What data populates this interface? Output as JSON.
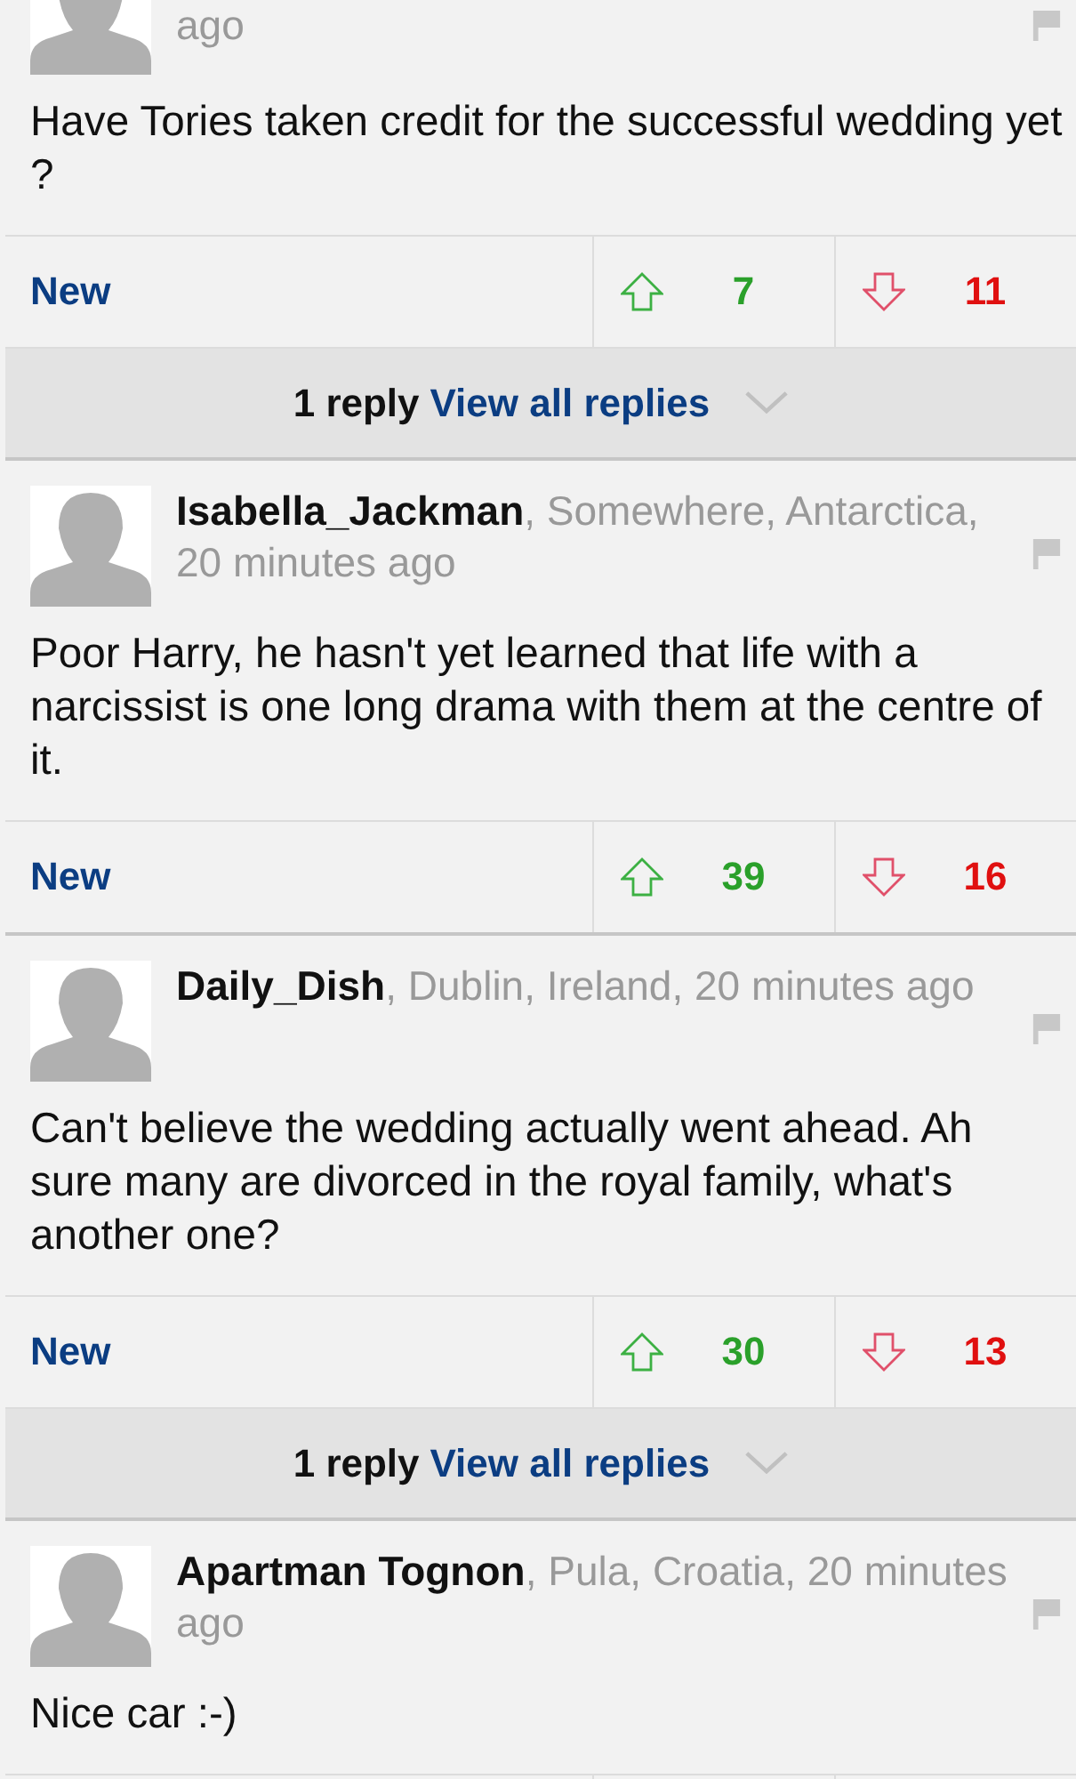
{
  "comments": [
    {
      "meta": "ago",
      "text": "Have Tories taken credit for the successful wedding yet ?",
      "actions": {
        "new_label": "New",
        "up": "7",
        "down": "11"
      },
      "replies": {
        "count": "1 reply",
        "link": "View all replies"
      }
    },
    {
      "name": "Isabella_Jackman",
      "meta": ", Somewhere, Antarctica, 20 minutes ago",
      "text": "Poor Harry, he hasn't yet learned that life with a narcissist is one long drama with them at the centre of it.",
      "actions": {
        "new_label": "New",
        "up": "39",
        "down": "16"
      }
    },
    {
      "name": "Daily_Dish",
      "meta": ", Dublin, Ireland, 20 minutes ago",
      "text": "Can't believe the wedding actually went ahead. Ah sure many are divorced in the royal family, what's another one?",
      "actions": {
        "new_label": "New",
        "up": "30",
        "down": "13"
      },
      "replies": {
        "count": "1 reply",
        "link": "View all replies"
      }
    },
    {
      "name": "Apartman Tognon",
      "meta": ", Pula, Croatia, 20 minutes ago",
      "text": "Nice car :-)"
    }
  ]
}
